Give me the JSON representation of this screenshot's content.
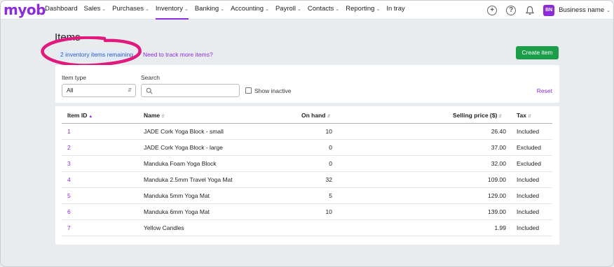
{
  "app": {
    "logo": "myob"
  },
  "nav": {
    "items": [
      {
        "label": "Dashboard",
        "chevron": false,
        "active": false
      },
      {
        "label": "Sales",
        "chevron": true,
        "active": false
      },
      {
        "label": "Purchases",
        "chevron": true,
        "active": false
      },
      {
        "label": "Inventory",
        "chevron": true,
        "active": true
      },
      {
        "label": "Banking",
        "chevron": true,
        "active": false
      },
      {
        "label": "Accounting",
        "chevron": true,
        "active": false
      },
      {
        "label": "Payroll",
        "chevron": true,
        "active": false
      },
      {
        "label": "Contacts",
        "chevron": true,
        "active": false
      },
      {
        "label": "Reporting",
        "chevron": true,
        "active": false
      },
      {
        "label": "In tray",
        "chevron": false,
        "active": false
      }
    ],
    "icons": [
      "plus-circle-icon",
      "help-circle-icon",
      "bell-icon"
    ],
    "avatar_initials": "BN",
    "business_name": "Business name"
  },
  "page": {
    "title": "Items",
    "items_remaining": "2 inventory items remaining",
    "track_more_link": "Need to track more items?",
    "create_button": "Create item"
  },
  "filters": {
    "item_type_label": "Item type",
    "item_type_value": "All",
    "search_label": "Search",
    "search_value": "",
    "show_inactive_label": "Show inactive",
    "show_inactive_checked": false,
    "reset_label": "Reset"
  },
  "table": {
    "columns": {
      "id": "Item ID",
      "name": "Name",
      "on_hand": "On hand",
      "price": "Selling price ($)",
      "tax": "Tax"
    },
    "rows": [
      {
        "id": "1",
        "name": "JADE Cork Yoga Block - small",
        "on_hand": "10",
        "price": "26.40",
        "tax": "Included"
      },
      {
        "id": "2",
        "name": "JADE Cork Yoga Block - large",
        "on_hand": "0",
        "price": "37.00",
        "tax": "Excluded"
      },
      {
        "id": "3",
        "name": "Manduka Foam Yoga Block",
        "on_hand": "0",
        "price": "32.00",
        "tax": "Excluded"
      },
      {
        "id": "4",
        "name": "Manduka 2.5mm Travel Yoga Mat",
        "on_hand": "32",
        "price": "109.00",
        "tax": "Included"
      },
      {
        "id": "5",
        "name": "Manduka 5mm Yoga Mat",
        "on_hand": "5",
        "price": "129.00",
        "tax": "Included"
      },
      {
        "id": "6",
        "name": "Manduka 6mm Yoga Mat",
        "on_hand": "10",
        "price": "139.00",
        "tax": "Included"
      },
      {
        "id": "7",
        "name": "Yellow Candles",
        "on_hand": "",
        "price": "1.99",
        "tax": "Included"
      }
    ]
  },
  "colors": {
    "brand": "#8b2bd9",
    "create_button": "#1c9d4a",
    "annotation": "#e0197d",
    "pill_bg": "#e3ebf9"
  }
}
